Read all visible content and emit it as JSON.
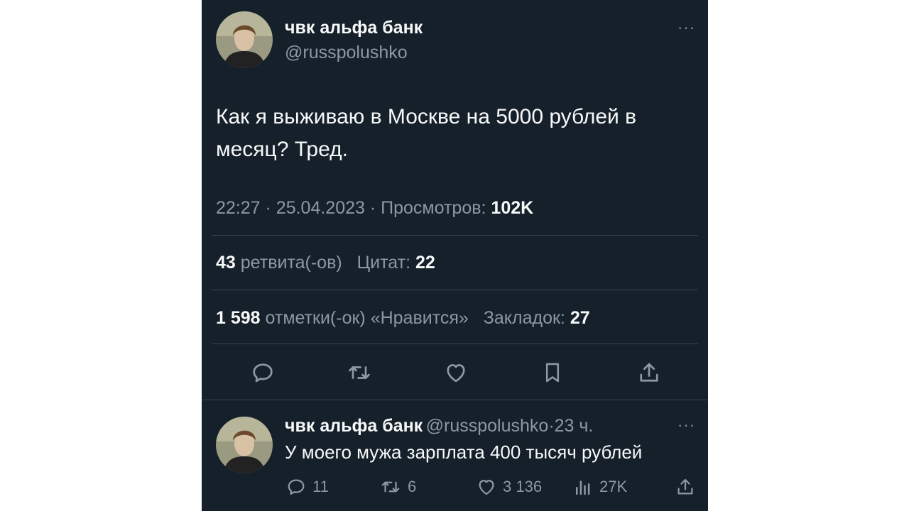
{
  "tweet": {
    "author_name": "чвк альфа банк",
    "author_handle": "@russpolushko",
    "more_label": "···",
    "text": "Как я выживаю в Москве на 5000 рублей в месяц? Тред.",
    "time": "22:27",
    "date": "25.04.2023",
    "separator": "·",
    "views_label": "Просмотров:",
    "views_value": "102K",
    "retweets_value": "43",
    "retweets_label": "ретвита(-ов)",
    "quotes_label": "Цитат:",
    "quotes_value": "22",
    "likes_value": "1 598",
    "likes_label": "отметки(-ок) «Нравится»",
    "bookmarks_label": "Закладок:",
    "bookmarks_value": "27",
    "actions": [
      "reply-icon",
      "retweet-icon",
      "like-icon",
      "bookmark-icon",
      "share-icon"
    ]
  },
  "reply": {
    "author_name": "чвк альфа банк",
    "author_handle": "@russpolushko",
    "separator": "·",
    "time": "23 ч.",
    "more_label": "···",
    "text": "У моего мужа зарплата 400 тысяч рублей",
    "replies": "11",
    "retweets": "6",
    "likes": "3 136",
    "views": "27K"
  },
  "colors": {
    "background": "#15202b",
    "primary_text": "#f7f9f9",
    "secondary_text": "#8b98a5",
    "divider": "#38444d"
  }
}
